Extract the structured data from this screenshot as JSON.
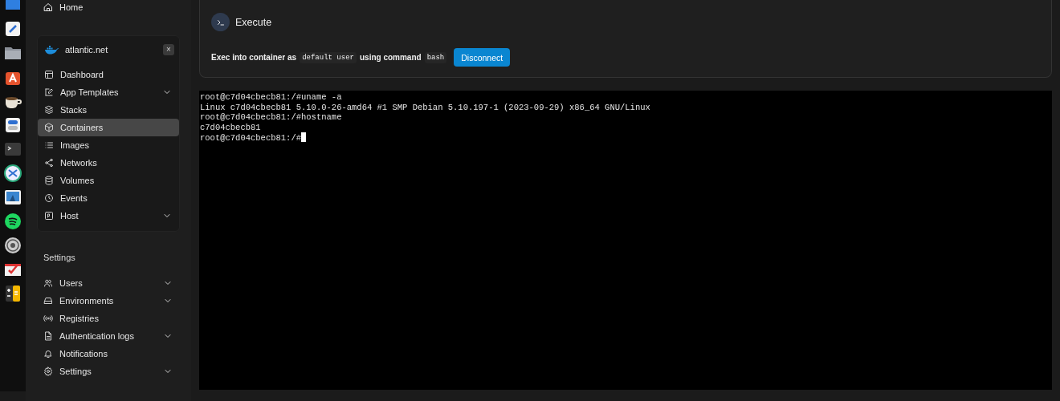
{
  "sidebar": {
    "home": {
      "label": "Home"
    },
    "environment": {
      "name": "atlantic.net",
      "close": "×",
      "items": [
        {
          "label": "Dashboard",
          "selected": false,
          "expandable": false
        },
        {
          "label": "App Templates",
          "selected": false,
          "expandable": true
        },
        {
          "label": "Stacks",
          "selected": false,
          "expandable": false
        },
        {
          "label": "Containers",
          "selected": true,
          "expandable": false
        },
        {
          "label": "Images",
          "selected": false,
          "expandable": false
        },
        {
          "label": "Networks",
          "selected": false,
          "expandable": false
        },
        {
          "label": "Volumes",
          "selected": false,
          "expandable": false
        },
        {
          "label": "Events",
          "selected": false,
          "expandable": false
        },
        {
          "label": "Host",
          "selected": false,
          "expandable": true
        }
      ]
    },
    "settings": {
      "heading": "Settings",
      "items": [
        {
          "label": "Users",
          "selected": false,
          "expandable": true
        },
        {
          "label": "Environments",
          "selected": false,
          "expandable": true
        },
        {
          "label": "Registries",
          "selected": false,
          "expandable": false
        },
        {
          "label": "Authentication logs",
          "selected": false,
          "expandable": true
        },
        {
          "label": "Notifications",
          "selected": false,
          "expandable": false
        },
        {
          "label": "Settings",
          "selected": false,
          "expandable": true
        }
      ]
    }
  },
  "execute": {
    "title": "Execute",
    "prefix": "Exec into container as",
    "user": "default user",
    "middle": "using command",
    "command": "bash",
    "button": "Disconnect"
  },
  "terminal": {
    "lines": [
      "root@c7d04cbecb81:/#uname -a",
      "Linux c7d04cbecb81 5.10.0-26-amd64 #1 SMP Debian 5.10.197-1 (2023-09-29) x86_64 GNU/Linux",
      "root@c7d04cbecb81:/#hostname",
      "c7d04cbecb81",
      "root@c7d04cbecb81:/#"
    ]
  }
}
